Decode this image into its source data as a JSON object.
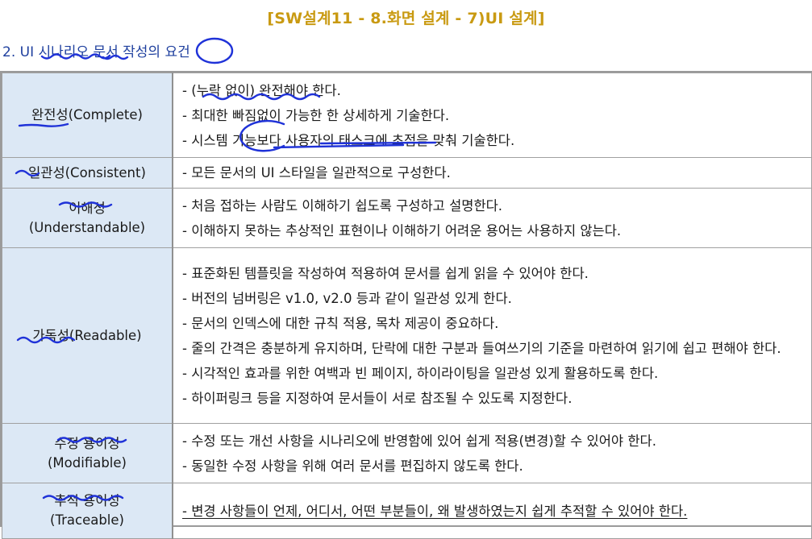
{
  "title": "[SW설계11 - 8.화면 설계 - 7)UI 설계]",
  "heading": "2. UI 시나리오 문서 작성의 요건",
  "colors": {
    "title": "#c99a12",
    "heading": "#1e3f9e",
    "label_bg": "#dce8f5",
    "pen": "#1f32d8"
  },
  "rows": [
    {
      "label": "완전성(Complete)",
      "label_sub": "",
      "items": [
        "- (누락 없이) 완전해야 한다.",
        "- 최대한 빠짐없이 가능한 한 상세하게 기술한다.",
        "- 시스템 기능보다 사용자의 태스크에 초점을 맞춰 기술한다."
      ]
    },
    {
      "label": "일관성(Consistent)",
      "label_sub": "",
      "items": [
        "- 모든 문서의 UI 스타일을 일관적으로 구성한다."
      ]
    },
    {
      "label": "이해성",
      "label_sub": "(Understandable)",
      "items": [
        "- 처음 접하는 사람도 이해하기 쉽도록 구성하고 설명한다.",
        "- 이해하지 못하는 추상적인 표현이나 이해하기 어려운 용어는 사용하지 않는다."
      ]
    },
    {
      "label": "가독성(Readable)",
      "label_sub": "",
      "items": [
        "- 표준화된 템플릿을 작성하여 적용하여 문서를 쉽게 읽을 수 있어야 한다.",
        "- 버전의 넘버링은 v1.0, v2.0 등과 같이 일관성 있게 한다.",
        "- 문서의 인덱스에 대한 규칙 적용, 목차 제공이 중요하다.",
        "- 줄의 간격은 충분하게 유지하며, 단락에 대한 구분과 들여쓰기의 기준을 마련하여 읽기에 쉽고 편해야 한다.",
        "- 시각적인 효과를 위한 여백과 빈 페이지, 하이라이팅을 일관성 있게 활용하도록 한다.",
        "- 하이퍼링크 등을 지정하여 문서들이 서로 참조될 수 있도록 지정한다."
      ]
    },
    {
      "label": "수정 용이성",
      "label_sub": "(Modifiable)",
      "items": [
        "- 수정 또는 개선 사항을 시나리오에 반영함에 있어 쉽게 적용(변경)할 수 있어야 한다.",
        "- 동일한 수정 사항을 위해 여러 문서를 편집하지 않도록 한다."
      ]
    },
    {
      "label": "추적 용이성",
      "label_sub": "(Traceable)",
      "items": [
        "- 변경 사항들이 언제, 어디서, 어떤 부분들이, 왜 발생하였는지 쉽게 추적할 수 있어야 한다."
      ]
    }
  ]
}
